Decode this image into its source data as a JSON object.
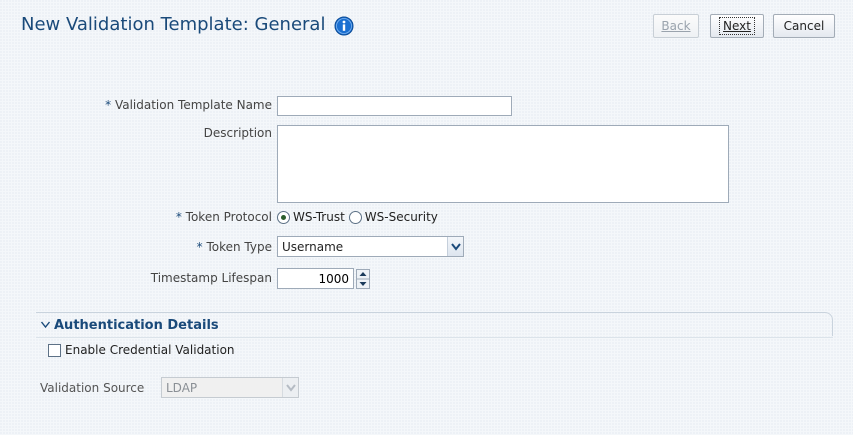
{
  "header": {
    "title": "New Validation Template: General",
    "info_icon": "info-icon",
    "back_label": "Back",
    "next_label": "Next",
    "cancel_label": "Cancel"
  },
  "form": {
    "template_name": {
      "required_mark": "*",
      "label": "Validation Template Name",
      "value": ""
    },
    "description": {
      "label": "Description",
      "value": ""
    },
    "token_protocol": {
      "required_mark": "*",
      "label": "Token Protocol",
      "options": [
        "WS-Trust",
        "WS-Security"
      ],
      "selected": "WS-Trust"
    },
    "token_type": {
      "required_mark": "*",
      "label": "Token Type",
      "selected": "Username"
    },
    "timestamp_lifespan": {
      "label": "Timestamp Lifespan",
      "value": "1000"
    }
  },
  "auth_section": {
    "title": "Authentication Details",
    "enable_credential_label": "Enable Credential Validation",
    "enable_credential_checked": false,
    "validation_source_label": "Validation Source",
    "validation_source_value": "LDAP"
  },
  "colors": {
    "title": "#1a4a7a",
    "accent": "#1a6fd1"
  }
}
